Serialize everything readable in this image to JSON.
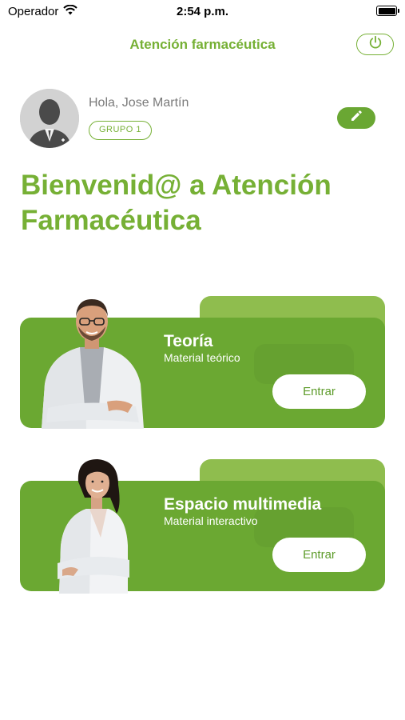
{
  "status_bar": {
    "carrier": "Operador",
    "time": "2:54 p.m."
  },
  "header": {
    "title": "Atención farmacéutica"
  },
  "user": {
    "greeting": "Hola, Jose Martín",
    "group": "GRUPO 1"
  },
  "welcome": {
    "line1": "Bienvenid@ a Atención",
    "line2": "Farmacéutica"
  },
  "cards": [
    {
      "title": "Teoría",
      "subtitle": "Material teórico",
      "button": "Entrar"
    },
    {
      "title": "Espacio multimedia",
      "subtitle": "Material interactivo",
      "button": "Entrar"
    }
  ],
  "colors": {
    "brand_green": "#76b035",
    "card_green": "#6ba832",
    "card_back_green": "#8fbd4e"
  },
  "icons": [
    "wifi-icon",
    "battery-icon",
    "power-icon",
    "pencil-icon",
    "avatar-placeholder-icon"
  ]
}
